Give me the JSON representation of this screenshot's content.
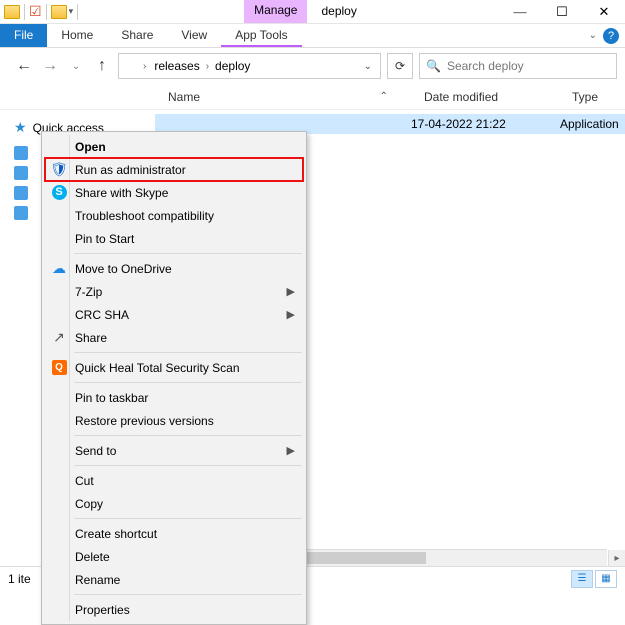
{
  "window": {
    "manage_label": "Manage",
    "title": "deploy"
  },
  "ribbon": {
    "file": "File",
    "home": "Home",
    "share": "Share",
    "view": "View",
    "app_tools": "App Tools"
  },
  "address": {
    "crumbs": [
      "releases",
      "deploy"
    ]
  },
  "search": {
    "placeholder": "Search deploy"
  },
  "columns": {
    "name": "Name",
    "date": "Date modified",
    "type": "Type"
  },
  "sidebar": {
    "quick_access": "Quick access"
  },
  "list": {
    "rows": [
      {
        "name": "",
        "date": "17-04-2022 21:22",
        "type": "Application"
      }
    ]
  },
  "context_menu": {
    "items": [
      {
        "key": "open",
        "label": "Open",
        "bold": true
      },
      {
        "key": "run-as-admin",
        "label": "Run as administrator",
        "icon": "shield",
        "highlight": true
      },
      {
        "key": "share-skype",
        "label": "Share with Skype",
        "icon": "skype"
      },
      {
        "key": "troubleshoot",
        "label": "Troubleshoot compatibility"
      },
      {
        "key": "pin-start",
        "label": "Pin to Start"
      },
      {
        "sep": true
      },
      {
        "key": "onedrive",
        "label": "Move to OneDrive",
        "icon": "cloud"
      },
      {
        "key": "7zip",
        "label": "7-Zip",
        "submenu": true
      },
      {
        "key": "crc",
        "label": "CRC SHA",
        "submenu": true
      },
      {
        "key": "share",
        "label": "Share",
        "icon": "share"
      },
      {
        "sep": true
      },
      {
        "key": "quickheal",
        "label": "Quick Heal Total Security Scan",
        "icon": "qh"
      },
      {
        "sep": true
      },
      {
        "key": "pin-taskbar",
        "label": "Pin to taskbar"
      },
      {
        "key": "restore",
        "label": "Restore previous versions"
      },
      {
        "sep": true
      },
      {
        "key": "sendto",
        "label": "Send to",
        "submenu": true
      },
      {
        "sep": true
      },
      {
        "key": "cut",
        "label": "Cut"
      },
      {
        "key": "copy",
        "label": "Copy"
      },
      {
        "sep": true
      },
      {
        "key": "shortcut",
        "label": "Create shortcut"
      },
      {
        "key": "delete",
        "label": "Delete"
      },
      {
        "key": "rename",
        "label": "Rename"
      },
      {
        "sep": true
      },
      {
        "key": "properties",
        "label": "Properties"
      }
    ]
  },
  "status": {
    "text": "1 ite"
  }
}
